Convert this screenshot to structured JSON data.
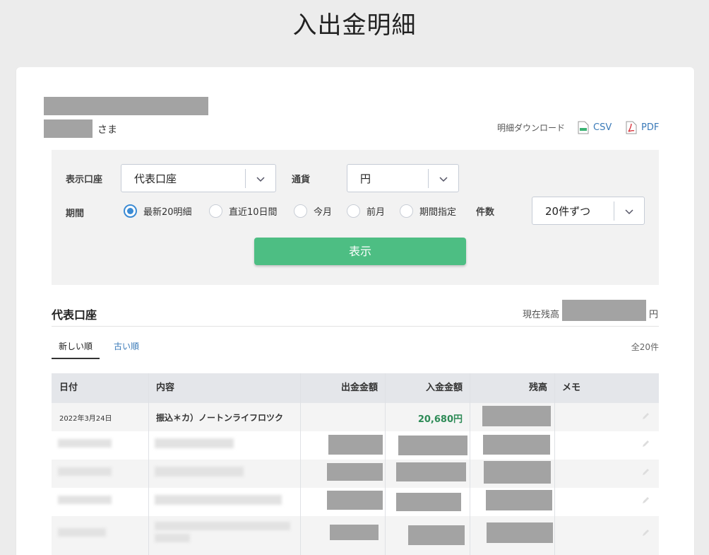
{
  "page": {
    "title": "入出金明細"
  },
  "customer": {
    "suffix": "さま"
  },
  "download": {
    "label": "明細ダウンロード",
    "csv_label": "CSV",
    "pdf_label": "PDF"
  },
  "filter": {
    "account_label": "表示口座",
    "account_value": "代表口座",
    "currency_label": "通貨",
    "currency_value": "円",
    "period_label": "期間",
    "period_options": [
      "最新20明細",
      "直近10日間",
      "今月",
      "前月",
      "期間指定"
    ],
    "period_selected": "最新20明細",
    "count_label": "件数",
    "count_value": "20件ずつ",
    "submit_label": "表示"
  },
  "account_section": {
    "title": "代表口座",
    "balance_label": "現在残高",
    "balance_unit": "円"
  },
  "sort_tabs": [
    {
      "label": "新しい順",
      "active": true
    },
    {
      "label": "古い順",
      "active": false
    }
  ],
  "total_count": "全20件",
  "table": {
    "headers": {
      "date": "日付",
      "description": "内容",
      "withdrawal": "出金金額",
      "deposit": "入金金額",
      "balance": "残高",
      "memo": "メモ"
    },
    "rows": [
      {
        "date": "2022年3月24日",
        "description": "振込＊カ）ノートンライフロツク",
        "withdrawal": "",
        "deposit": "20,680円"
      }
    ]
  },
  "colors": {
    "accent_green": "#4dbe83",
    "link_blue": "#3a7ab8",
    "deposit_green": "#2e8b57",
    "radio_blue": "#3b8bd4"
  }
}
